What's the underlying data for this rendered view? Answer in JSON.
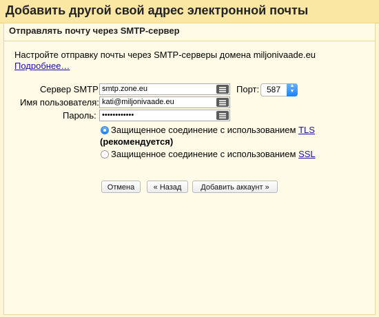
{
  "header": {
    "title": "Добавить другой свой адрес электронной почты"
  },
  "section": {
    "title": "Отправлять почту через SMTP-сервер"
  },
  "intro": {
    "text": "Настройте отправку почты через SMTP-серверы домена miljonivaade.eu",
    "more_link": "Подробнее…"
  },
  "form": {
    "smtp_label": "Сервер SMTP:",
    "smtp_value": "smtp.zone.eu",
    "port_label": "Порт:",
    "port_value": "587",
    "user_label": "Имя пользователя:",
    "user_value": "kati@miljonivaade.eu",
    "password_label": "Пароль:",
    "password_value": "••••••••••••"
  },
  "security": {
    "tls_text": "Защищенное соединение с использованием",
    "tls_link": "TLS",
    "tls_recommended": "(рекомендуется)",
    "tls_selected": true,
    "ssl_text": "Защищенное соединение с использованием",
    "ssl_link": "SSL"
  },
  "buttons": {
    "cancel": "Отмена",
    "back": "« Назад",
    "add": "Добавить аккаунт »"
  },
  "icons": {
    "field_icon": "keyboard-icon",
    "select_arrow": "updown-arrow-icon"
  },
  "colors": {
    "header_bg": "#f9e7a3",
    "panel_bg": "#fffbe6",
    "link": "#1a0dab",
    "accent": "#1a82fb"
  }
}
